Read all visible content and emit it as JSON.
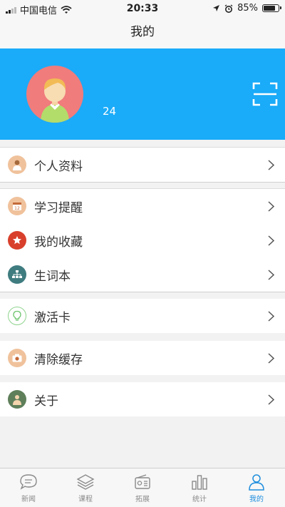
{
  "status_bar": {
    "carrier": "中国电信",
    "time": "20:33",
    "battery_percent": "85%",
    "battery_level": 0.85,
    "icons": [
      "signal-icon",
      "wifi-icon",
      "location-icon",
      "alarm-icon",
      "battery-icon"
    ]
  },
  "header": {
    "title": "我的"
  },
  "profile": {
    "number": "24",
    "avatar_bg": "#f07c7c",
    "banner_color": "#1aabf9"
  },
  "menu": {
    "groups": [
      {
        "items": [
          {
            "label": "个人资料",
            "icon": "person-icon"
          }
        ]
      },
      {
        "items": [
          {
            "label": "学习提醒",
            "icon": "calendar-icon"
          },
          {
            "label": "我的收藏",
            "icon": "star-icon"
          },
          {
            "label": "生词本",
            "icon": "hierarchy-icon"
          }
        ]
      },
      {
        "items": [
          {
            "label": "激活卡",
            "icon": "lightbulb-icon"
          }
        ]
      },
      {
        "items": [
          {
            "label": "清除缓存",
            "icon": "camera-icon"
          }
        ]
      },
      {
        "items": [
          {
            "label": "关于",
            "icon": "person-landscape-icon"
          }
        ]
      }
    ]
  },
  "tab_bar": {
    "active_color": "#1e8ede",
    "tabs": [
      {
        "label": "新闻",
        "icon": "chat-bubble-icon"
      },
      {
        "label": "课程",
        "icon": "layers-icon"
      },
      {
        "label": "拓展",
        "icon": "radio-icon"
      },
      {
        "label": "统计",
        "icon": "bar-chart-icon"
      },
      {
        "label": "我的",
        "icon": "user-icon",
        "active": true
      }
    ]
  }
}
